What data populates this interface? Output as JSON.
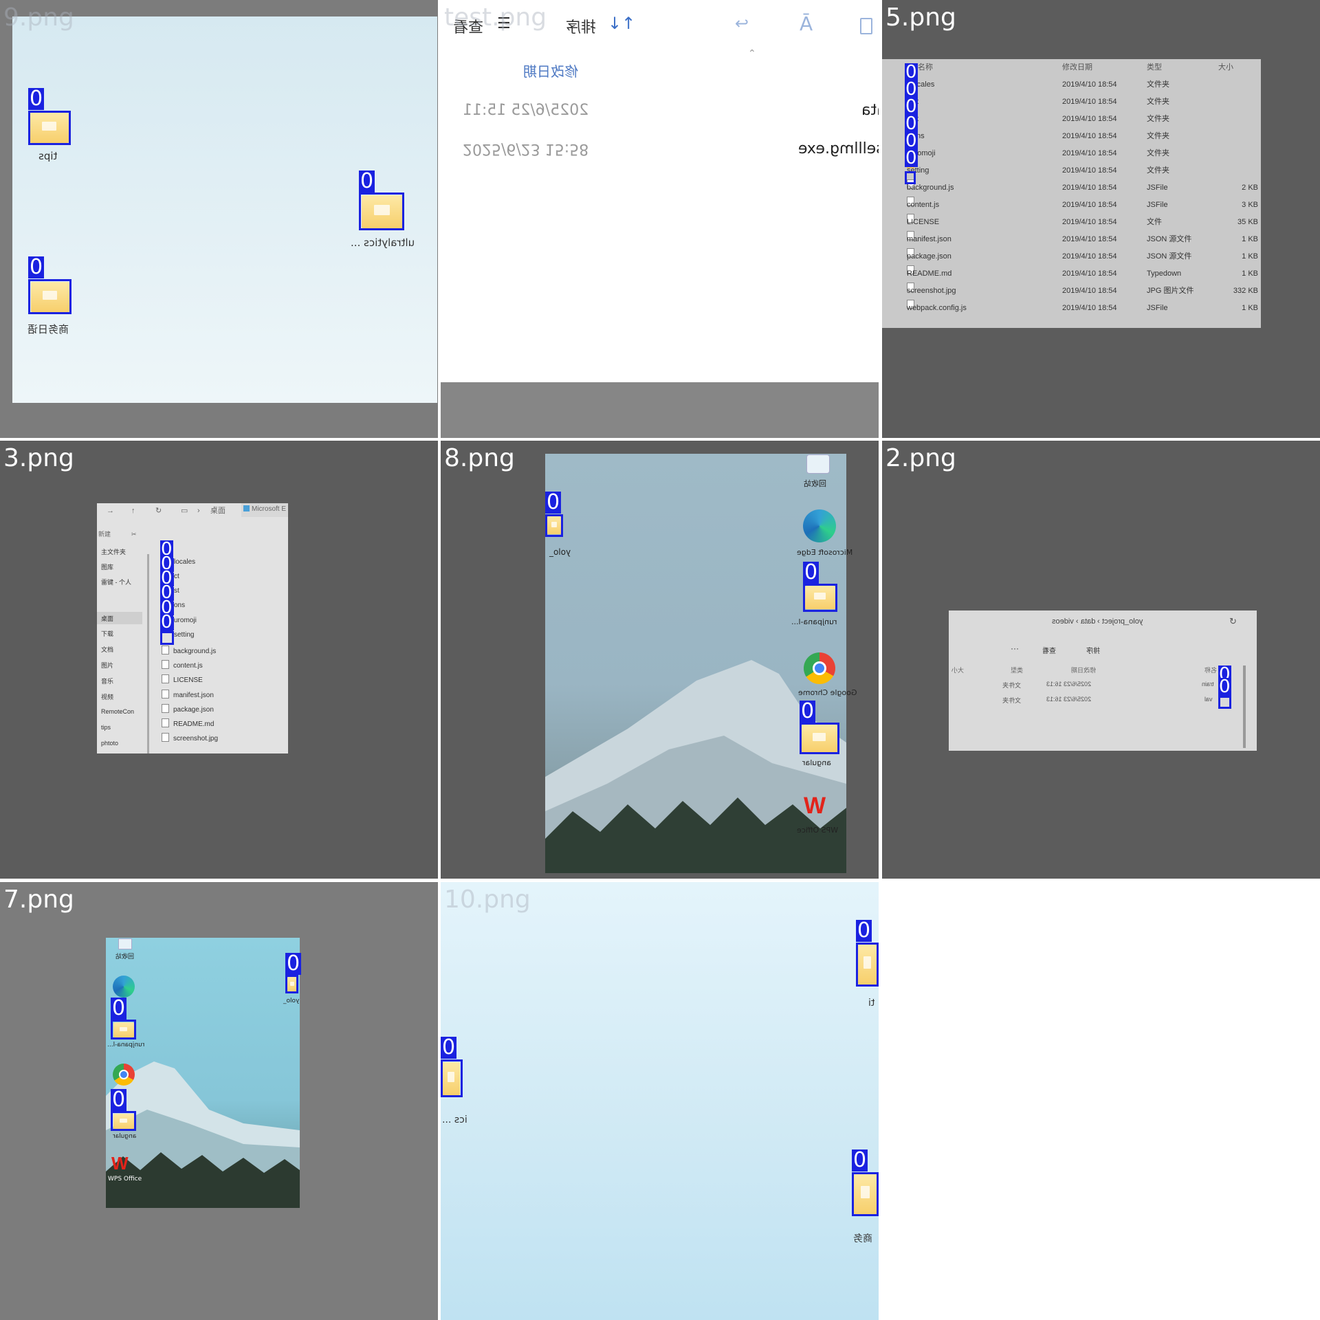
{
  "tiles": {
    "t9": {
      "label": "9.png",
      "icons": [
        {
          "name": "tips",
          "text": "tips"
        },
        {
          "name": "ultralytics",
          "text": "ultralytics ..."
        },
        {
          "name": "diary",
          "text": "商务日语"
        }
      ],
      "class_label": "0"
    },
    "ttest": {
      "label": "test.png",
      "toolbar": {
        "view": "查看",
        "sort": "排序"
      },
      "column_date": "修改日期",
      "rows": [
        {
          "date": "2025/6/25 15:11",
          "name": "data"
        },
        {
          "date": "2025/6/23 15:58",
          "name": "selllmg.exe"
        }
      ]
    },
    "t5": {
      "label": "5.png",
      "columns": {
        "name": "名称",
        "date": "修改日期",
        "type": "类型",
        "size": "大小"
      },
      "rows": [
        {
          "name": "_locales",
          "date": "2019/4/10 18:54",
          "type": "文件夹",
          "size": ""
        },
        {
          "name": "dict",
          "date": "2019/4/10 18:54",
          "type": "文件夹",
          "size": ""
        },
        {
          "name": "dist",
          "date": "2019/4/10 18:54",
          "type": "文件夹",
          "size": ""
        },
        {
          "name": "icons",
          "date": "2019/4/10 18:54",
          "type": "文件夹",
          "size": ""
        },
        {
          "name": "kuromoji",
          "date": "2019/4/10 18:54",
          "type": "文件夹",
          "size": ""
        },
        {
          "name": "setting",
          "date": "2019/4/10 18:54",
          "type": "文件夹",
          "size": ""
        },
        {
          "name": "background.js",
          "date": "2019/4/10 18:54",
          "type": "JSFile",
          "size": "2 KB"
        },
        {
          "name": "content.js",
          "date": "2019/4/10 18:54",
          "type": "JSFile",
          "size": "3 KB"
        },
        {
          "name": "LICENSE",
          "date": "2019/4/10 18:54",
          "type": "文件",
          "size": "35 KB"
        },
        {
          "name": "manifest.json",
          "date": "2019/4/10 18:54",
          "type": "JSON 源文件",
          "size": "1 KB"
        },
        {
          "name": "package.json",
          "date": "2019/4/10 18:54",
          "type": "JSON 源文件",
          "size": "1 KB"
        },
        {
          "name": "README.md",
          "date": "2019/4/10 18:54",
          "type": "Typedown",
          "size": "1 KB"
        },
        {
          "name": "screenshot.jpg",
          "date": "2019/4/10 18:54",
          "type": "JPG 图片文件",
          "size": "332 KB"
        },
        {
          "name": "webpack.config.js",
          "date": "2019/4/10 18:54",
          "type": "JSFile",
          "size": "1 KB"
        }
      ]
    },
    "t3": {
      "label": "3.png",
      "breadcrumb": "桌面",
      "edge_tab": "Microsoft E",
      "new_btn": "新建",
      "sidebar": [
        "主文件夹",
        "图库",
        "雷键 - 个人",
        "桌面",
        "下载",
        "文档",
        "图片",
        "音乐",
        "视频",
        "RemoteCon",
        "tips",
        "phtoto"
      ],
      "files": [
        "locales",
        "ct",
        "st",
        "ons",
        "uromoji",
        "setting",
        "background.js",
        "content.js",
        "LICENSE",
        "manifest.json",
        "package.json",
        "README.md",
        "screenshot.jpg"
      ]
    },
    "t8": {
      "label": "8.png",
      "icons": [
        {
          "name": "recycle",
          "text": "回收站"
        },
        {
          "name": "yolo",
          "text": "yolo_"
        },
        {
          "name": "edge",
          "text": "Microsoft Edge"
        },
        {
          "name": "runjpana",
          "text": "runjpana-l..."
        },
        {
          "name": "chrome",
          "text": "Google Chrome"
        },
        {
          "name": "angular",
          "text": "angular"
        },
        {
          "name": "wps",
          "text": "WPS Office"
        }
      ]
    },
    "t2": {
      "label": "2.png",
      "breadcrumb": [
        "videos",
        "data",
        "yolo_project"
      ],
      "toolbar": {
        "more": "···",
        "view": "查看",
        "sort": "排序"
      },
      "columns": {
        "size": "大小",
        "type": "类型",
        "date": "修改日期",
        "name": "名称"
      },
      "rows": [
        {
          "type": "文件夹",
          "date": "2025/6/23 16:13",
          "name": "train"
        },
        {
          "type": "文件夹",
          "date": "2025/6/23 16:13",
          "name": "val"
        }
      ]
    },
    "t7": {
      "label": "7.png",
      "icons": [
        {
          "name": "recycle",
          "text": "回收站"
        },
        {
          "name": "yolo",
          "text": "yolo_"
        },
        {
          "name": "runjpana",
          "text": "runjpana-l..."
        },
        {
          "name": "angular",
          "text": "angular"
        },
        {
          "name": "wps",
          "text": "WPS Office"
        }
      ]
    },
    "t10": {
      "label": "10.png",
      "icons": [
        {
          "name": "ti",
          "text": "ti"
        },
        {
          "name": "ics",
          "text": "ics ..."
        },
        {
          "name": "shang",
          "text": "商务"
        }
      ]
    }
  },
  "colors": {
    "box": "#1a22e0",
    "tile_bg": "#5c5c5c",
    "grid_line": "#ffffff"
  }
}
